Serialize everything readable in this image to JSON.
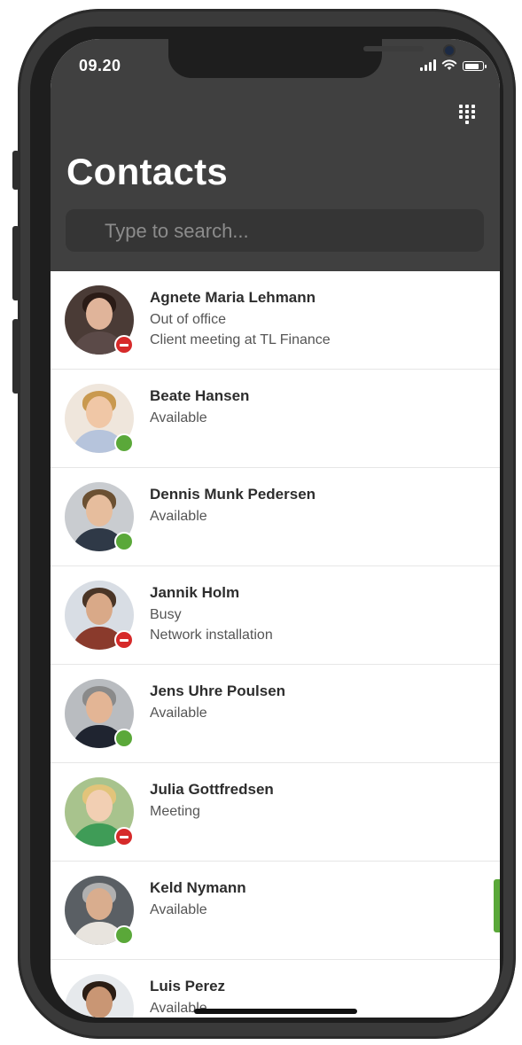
{
  "status_bar": {
    "time": "09.20"
  },
  "header": {
    "title": "Contacts"
  },
  "search": {
    "placeholder": "Type to search..."
  },
  "icons": {
    "dialpad": "dialpad-icon",
    "signal": "signal-icon",
    "wifi": "wifi-icon",
    "battery": "battery-icon"
  },
  "colors": {
    "header_bg": "#404040",
    "available": "#5aa839",
    "busy": "#d62a2a"
  },
  "contacts": [
    {
      "name": "Agnete Maria Lehmann",
      "status": "Out of office",
      "note": "Client meeting at TL Finance",
      "presence": "busy"
    },
    {
      "name": "Beate Hansen",
      "status": "Available",
      "note": "",
      "presence": "available"
    },
    {
      "name": "Dennis Munk Pedersen",
      "status": "Available",
      "note": "",
      "presence": "available"
    },
    {
      "name": "Jannik Holm",
      "status": "Busy",
      "note": "Network installation",
      "presence": "busy"
    },
    {
      "name": "Jens Uhre Poulsen",
      "status": "Available",
      "note": "",
      "presence": "available"
    },
    {
      "name": "Julia Gottfredsen",
      "status": "Meeting",
      "note": "",
      "presence": "busy"
    },
    {
      "name": "Keld Nymann",
      "status": "Available",
      "note": "",
      "presence": "available"
    },
    {
      "name": "Luis Perez",
      "status": "Available",
      "note": "",
      "presence": "available"
    }
  ]
}
